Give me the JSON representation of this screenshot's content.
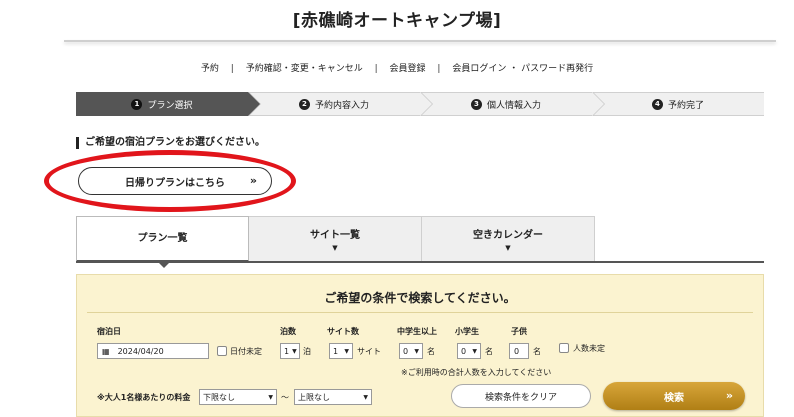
{
  "site_title": "[赤礁崎オートキャンプ場]",
  "topnav": {
    "items": [
      "予約",
      "予約確認・変更・キャンセル",
      "会員登録",
      "会員ログイン ・ パスワード再発行"
    ],
    "separator": "|"
  },
  "steps": [
    {
      "num": "1",
      "label": "プラン選択"
    },
    {
      "num": "2",
      "label": "予約内容入力"
    },
    {
      "num": "3",
      "label": "個人情報入力"
    },
    {
      "num": "4",
      "label": "予約完了"
    }
  ],
  "heading": "ご希望の宿泊プランをお選びください。",
  "dayplan_button": {
    "label": "日帰りプランはこちら",
    "arrow": "»"
  },
  "tabs": [
    {
      "label": "プラン一覧",
      "caret": ""
    },
    {
      "label": "サイト一覧",
      "caret": "▼"
    },
    {
      "label": "空きカレンダー",
      "caret": "▼"
    }
  ],
  "search": {
    "title": "ご希望の条件で検索してください。",
    "checkin_label": "宿泊日",
    "checkin_value": "2024/04/20",
    "date_undecided": "日付未定",
    "nights_label": "泊数",
    "nights_value": "1",
    "nights_unit": "泊",
    "sites_label": "サイト数",
    "sites_value": "1",
    "sites_unit": "サイト",
    "junior_high_label": "中学生以上",
    "junior_high_value": "0",
    "elementary_label": "小学生",
    "elementary_value": "0",
    "child_label": "子供",
    "child_value": "0",
    "person_unit": "名",
    "headcount_undecided": "人数未定",
    "note": "※ご利用時の合計人数を入力してください",
    "price_label": "※大人1名様あたりの料金",
    "price_min": "下限なし",
    "price_tilde": "～",
    "price_max": "上限なし",
    "clear_label": "検索条件をクリア",
    "search_label": "検索",
    "search_arrow": "»"
  },
  "colors": {
    "active_step": "#555555",
    "search_bg": "#fbf3d0",
    "search_button": "#c4921f",
    "highlight_ring": "#e1151b"
  },
  "icons": {
    "calendar": "calendar-icon",
    "dropdown": "dropdown-arrow-icon"
  }
}
